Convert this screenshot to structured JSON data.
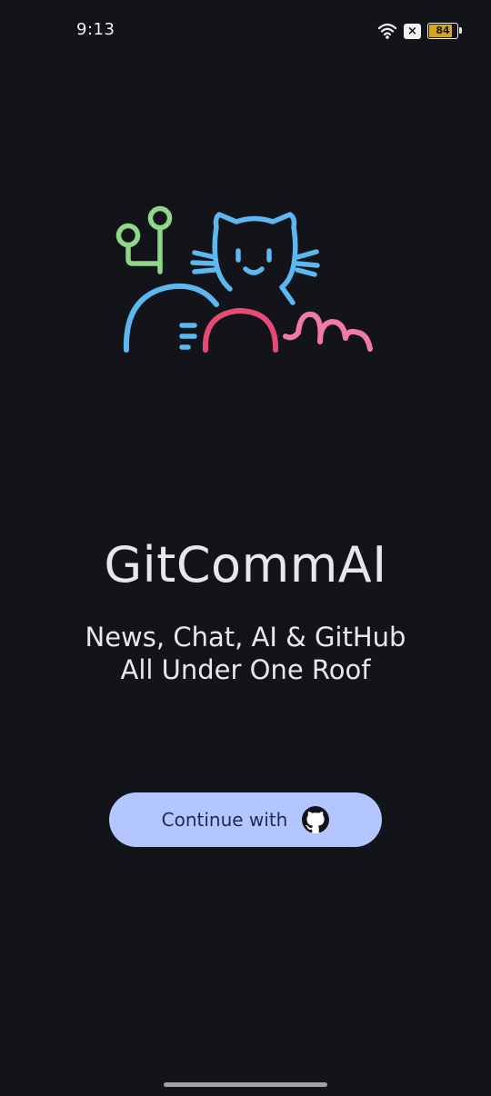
{
  "status_bar": {
    "time": "9:13",
    "battery_level": "84",
    "battery_fraction": 0.84,
    "icons": [
      "wifi-icon",
      "sim-disabled-icon",
      "battery-icon"
    ]
  },
  "hero": {
    "illustration": "github-octocat-mascot",
    "colors": {
      "green": "#8fd889",
      "blue": "#5cb8f0",
      "red": "#e54b76",
      "pink": "#f17aa6"
    }
  },
  "app": {
    "title": "GitCommAI",
    "tagline_line1": "News, Chat, AI & GitHub",
    "tagline_line2": "All Under One Roof"
  },
  "auth": {
    "continue_label": "Continue with",
    "provider_icon": "github-icon"
  },
  "theme": {
    "background": "#13141a",
    "button": "#b3c6ff",
    "button_text": "#1a2c55",
    "text": "#e8e8ec"
  }
}
